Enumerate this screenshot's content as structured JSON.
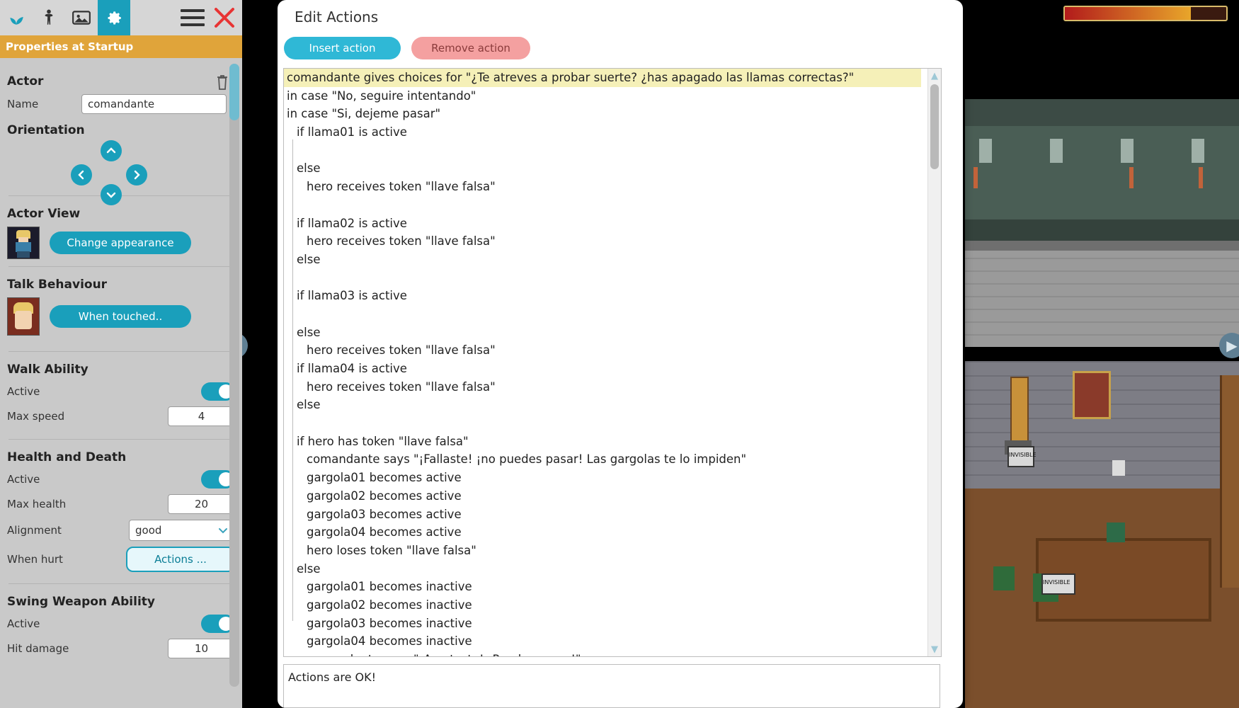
{
  "toolbar": {
    "buttons": [
      {
        "name": "plant-tool",
        "active": false
      },
      {
        "name": "person-tool",
        "active": false
      },
      {
        "name": "image-tool",
        "active": false
      },
      {
        "name": "settings-tool",
        "active": true
      }
    ],
    "menu_label": "menu",
    "close_label": "close"
  },
  "panel": {
    "title": "Properties at Startup",
    "actor_section": "Actor",
    "name_label": "Name",
    "name_value": "comandante",
    "orientation_section": "Orientation",
    "actor_view_section": "Actor View",
    "change_appearance": "Change appearance",
    "talk_behaviour_section": "Talk Behaviour",
    "when_touched": "When touched..",
    "walk_ability_section": "Walk Ability",
    "walk_active_label": "Active",
    "max_speed_label": "Max speed",
    "max_speed_value": "4",
    "health_section": "Health and Death",
    "health_active_label": "Active",
    "max_health_label": "Max health",
    "max_health_value": "20",
    "alignment_label": "Alignment",
    "alignment_value": "good",
    "when_hurt_label": "When hurt",
    "when_hurt_button": "Actions ...",
    "swing_section": "Swing Weapon Ability",
    "swing_active_label": "Active",
    "hit_damage_label": "Hit damage",
    "hit_damage_value": "10"
  },
  "dialog": {
    "title": "Edit Actions",
    "insert_action": "Insert action",
    "remove_action": "Remove action",
    "status": "Actions are OK!",
    "lines": [
      {
        "text": "comandante gives choices for \"¿Te atreves a probar suerte? ¿has apagado las llamas correctas?\"",
        "indent": 0,
        "selected": true
      },
      {
        "text": "in case \"No, seguire intentando\"",
        "indent": 0,
        "selected": false
      },
      {
        "text": "in case \"Si, dejeme pasar\"",
        "indent": 0,
        "selected": false
      },
      {
        "text": "if llama01 is active",
        "indent": 1,
        "selected": false
      },
      {
        "text": "",
        "indent": 2,
        "selected": false
      },
      {
        "text": "else",
        "indent": 1,
        "selected": false
      },
      {
        "text": "hero receives token \"llave falsa\"",
        "indent": 2,
        "selected": false
      },
      {
        "text": "",
        "indent": 2,
        "selected": false
      },
      {
        "text": "if llama02 is active",
        "indent": 1,
        "selected": false
      },
      {
        "text": "hero receives token \"llave falsa\"",
        "indent": 2,
        "selected": false
      },
      {
        "text": "else",
        "indent": 1,
        "selected": false
      },
      {
        "text": "",
        "indent": 2,
        "selected": false
      },
      {
        "text": "if llama03 is active",
        "indent": 1,
        "selected": false
      },
      {
        "text": "",
        "indent": 2,
        "selected": false
      },
      {
        "text": "else",
        "indent": 1,
        "selected": false
      },
      {
        "text": "hero receives token \"llave falsa\"",
        "indent": 2,
        "selected": false
      },
      {
        "text": "if llama04 is active",
        "indent": 1,
        "selected": false
      },
      {
        "text": "hero receives token \"llave falsa\"",
        "indent": 2,
        "selected": false
      },
      {
        "text": "else",
        "indent": 1,
        "selected": false
      },
      {
        "text": "",
        "indent": 2,
        "selected": false
      },
      {
        "text": "if hero has token \"llave falsa\"",
        "indent": 1,
        "selected": false
      },
      {
        "text": "comandante says \"¡Fallaste! ¡no puedes pasar! Las gargolas te lo impiden\"",
        "indent": 2,
        "selected": false
      },
      {
        "text": "gargola01 becomes active",
        "indent": 2,
        "selected": false
      },
      {
        "text": "gargola02 becomes active",
        "indent": 2,
        "selected": false
      },
      {
        "text": "gargola03 becomes active",
        "indent": 2,
        "selected": false
      },
      {
        "text": "gargola04 becomes active",
        "indent": 2,
        "selected": false
      },
      {
        "text": "hero loses token \"llave falsa\"",
        "indent": 2,
        "selected": false
      },
      {
        "text": "else",
        "indent": 1,
        "selected": false
      },
      {
        "text": "gargola01 becomes inactive",
        "indent": 2,
        "selected": false
      },
      {
        "text": "gargola02 becomes inactive",
        "indent": 2,
        "selected": false
      },
      {
        "text": "gargola03 becomes inactive",
        "indent": 2,
        "selected": false
      },
      {
        "text": "gargola04 becomes inactive",
        "indent": 2,
        "selected": false
      },
      {
        "text": "comandante says \"¡Acertaste! ¡Puedes pasar!\"",
        "indent": 2,
        "selected": false
      }
    ]
  },
  "game": {
    "health_percent": 78,
    "left_arrow": "◀",
    "right_arrow": "▶",
    "invisible_label_1": "INVISIBLE",
    "invisible_label_2": "INVISIBLE"
  },
  "colors": {
    "accent": "#1a9fbb",
    "title_bar": "#e0a43a",
    "panel_bg": "#c9c9c9",
    "selection": "#f5f0b8",
    "insert_btn": "#2fb8d6",
    "remove_btn": "#f4a0a0"
  }
}
